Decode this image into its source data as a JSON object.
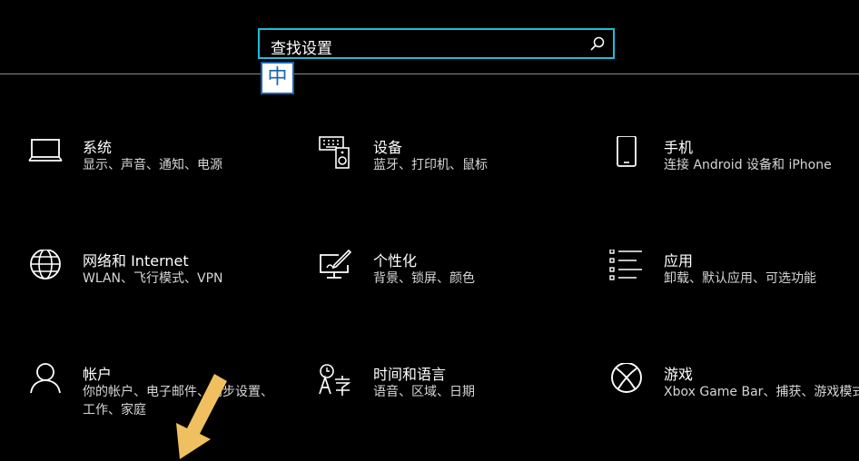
{
  "search": {
    "text": "查找设置"
  },
  "ime": {
    "label": "中"
  },
  "tiles": [
    {
      "title": "系统",
      "desc": "显示、声音、通知、电源",
      "icon": "laptop-icon"
    },
    {
      "title": "设备",
      "desc": "蓝牙、打印机、鼠标",
      "icon": "devices-icon"
    },
    {
      "title": "手机",
      "desc": "连接 Android 设备和 iPhone",
      "icon": "phone-icon"
    },
    {
      "title": "网络和 Internet",
      "desc": "WLAN、飞行模式、VPN",
      "icon": "globe-icon"
    },
    {
      "title": "个性化",
      "desc": "背景、锁屏、颜色",
      "icon": "personalize-icon"
    },
    {
      "title": "应用",
      "desc": "卸载、默认应用、可选功能",
      "icon": "apps-list-icon"
    },
    {
      "title": "帐户",
      "desc": "你的帐户、电子邮件、同步设置、工作、家庭",
      "icon": "person-icon"
    },
    {
      "title": "时间和语言",
      "desc": "语音、区域、日期",
      "icon": "time-language-icon"
    },
    {
      "title": "游戏",
      "desc": "Xbox Game Bar、捕获、游戏模式",
      "icon": "xbox-icon"
    }
  ],
  "colors": {
    "accent": "#21bcd8",
    "ime_blue": "#1a64b4",
    "arrow": "#f0c060"
  }
}
